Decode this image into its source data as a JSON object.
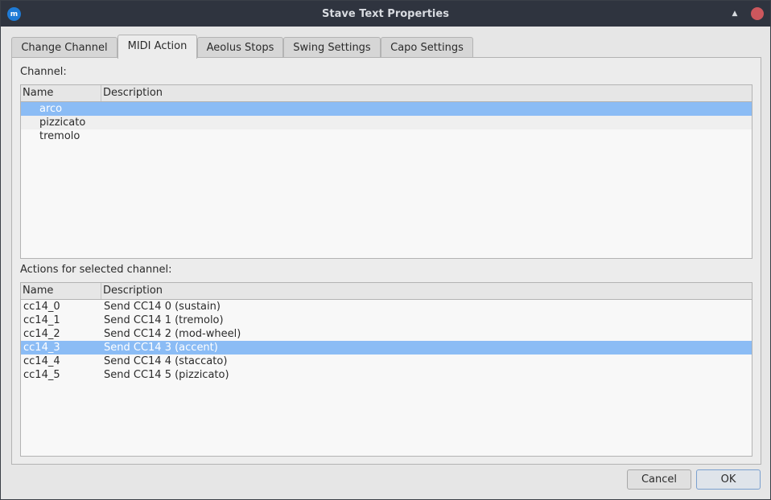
{
  "window": {
    "title": "Stave Text Properties",
    "app_icon": "musescore-icon"
  },
  "tabs": [
    {
      "label": "Change Channel"
    },
    {
      "label": "MIDI Action"
    },
    {
      "label": "Aeolus Stops"
    },
    {
      "label": "Swing Settings"
    },
    {
      "label": "Capo Settings"
    }
  ],
  "active_tab": "MIDI Action",
  "channel_section": {
    "label": "Channel:",
    "columns": [
      "Name",
      "Description"
    ],
    "rows": [
      {
        "name": "arco",
        "description": ""
      },
      {
        "name": "pizzicato",
        "description": ""
      },
      {
        "name": "tremolo",
        "description": ""
      }
    ],
    "selected": "arco"
  },
  "actions_section": {
    "label": "Actions for selected channel:",
    "columns": [
      "Name",
      "Description"
    ],
    "rows": [
      {
        "name": "cc14_0",
        "description": "Send CC14 0 (sustain)"
      },
      {
        "name": "cc14_1",
        "description": "Send CC14 1 (tremolo)"
      },
      {
        "name": "cc14_2",
        "description": "Send CC14 2 (mod-wheel)"
      },
      {
        "name": "cc14_3",
        "description": "Send CC14 3 (accent)"
      },
      {
        "name": "cc14_4",
        "description": "Send CC14 4 (staccato)"
      },
      {
        "name": "cc14_5",
        "description": "Send CC14 5 (pizzicato)"
      }
    ],
    "selected": "cc14_3"
  },
  "buttons": {
    "cancel": "Cancel",
    "ok": "OK"
  },
  "colors": {
    "selection": "#8bbcf5",
    "titlebar": "#2f343f",
    "close": "#cc575d"
  }
}
